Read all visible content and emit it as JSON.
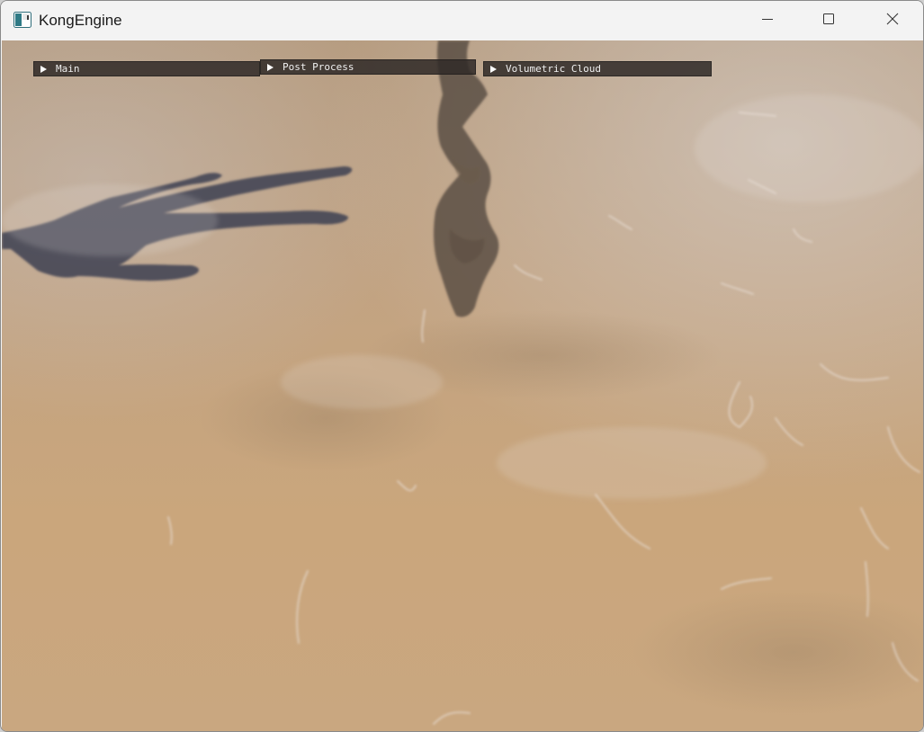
{
  "window": {
    "title": "KongEngine",
    "icon": "app-window-icon",
    "controls": {
      "minimize": "minimize-icon",
      "maximize": "maximize-icon",
      "close": "close-icon"
    }
  },
  "panels": [
    {
      "id": "main",
      "label": "Main",
      "collapsed": true
    },
    {
      "id": "post",
      "label": "Post Process",
      "collapsed": true
    },
    {
      "id": "cloud",
      "label": "Volumetric Cloud",
      "collapsed": true
    }
  ],
  "colors": {
    "sand": "#c4a582",
    "header_bg": "#302a28",
    "shadow": "#3a3a48"
  }
}
